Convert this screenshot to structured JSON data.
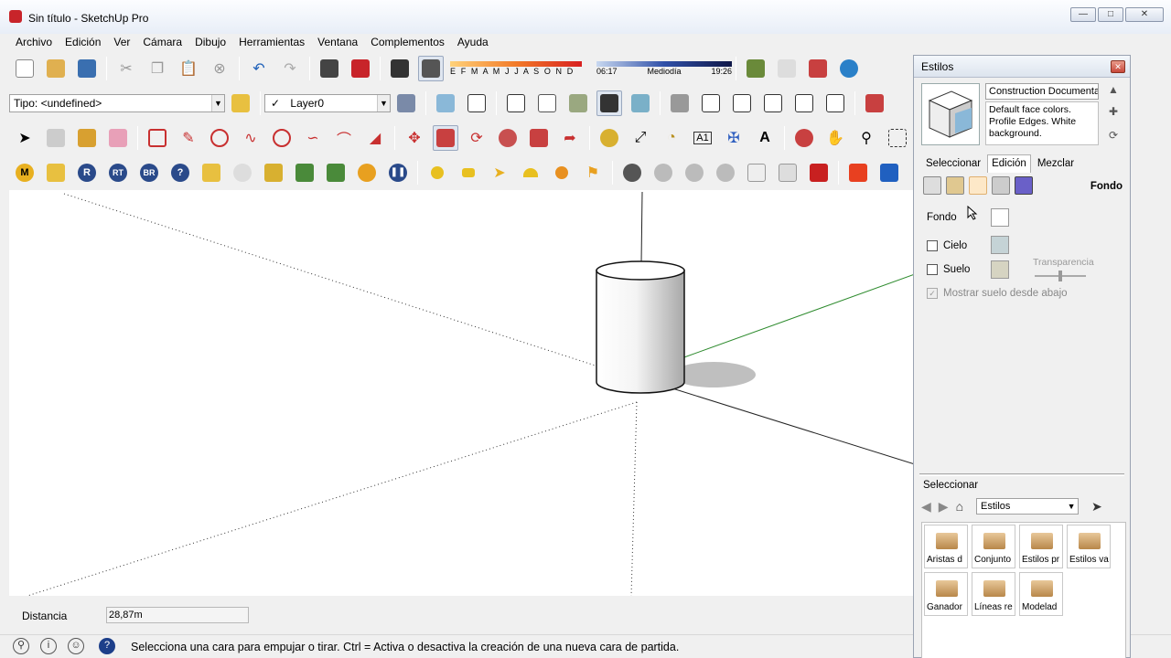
{
  "window": {
    "title": "Sin título - SketchUp Pro"
  },
  "menu": [
    "Archivo",
    "Edición",
    "Ver",
    "Cámara",
    "Dibujo",
    "Herramientas",
    "Ventana",
    "Complementos",
    "Ayuda"
  ],
  "toolbar": {
    "shadow_months": "E F M A M J J A S O N D",
    "shadow_time_start": "06:17",
    "shadow_time_mid": "Mediodía",
    "shadow_time_end": "19:26",
    "tipo_label": "Tipo: <undefined>",
    "layer_label": "Layer0"
  },
  "measure": {
    "label": "Distancia",
    "value": "28,87m"
  },
  "status": {
    "message": "Selecciona una cara para empujar o tirar. Ctrl = Activa o desactiva la creación de una nueva cara de partida."
  },
  "styles_panel": {
    "title": "Estilos",
    "style_name": "Construction Documenta",
    "style_description": "Default face colors. Profile Edges. White background.",
    "tabs": [
      "Seleccionar",
      "Edición",
      "Mezclar"
    ],
    "section_heading": "Fondo",
    "background_rows": [
      {
        "label": "Fondo",
        "color": "#ffffff"
      },
      {
        "label": "Cielo",
        "color": "#c5d3d6"
      },
      {
        "label": "Suelo",
        "color": "#d6d4c2"
      }
    ],
    "transparency_label": "Transparencia",
    "show_ground_label": "Mostrar suelo desde abajo",
    "browser_label": "Seleccionar",
    "browser_dropdown": "Estilos",
    "folders": [
      "Aristas d",
      "Conjunto",
      "Estilos pr",
      "Estilos va",
      "Ganador",
      "Líneas re",
      "Modelad"
    ]
  },
  "colors": {
    "accent": "#c8242a",
    "axis_green": "#2e8b2e",
    "axis_red": "#c83232"
  }
}
